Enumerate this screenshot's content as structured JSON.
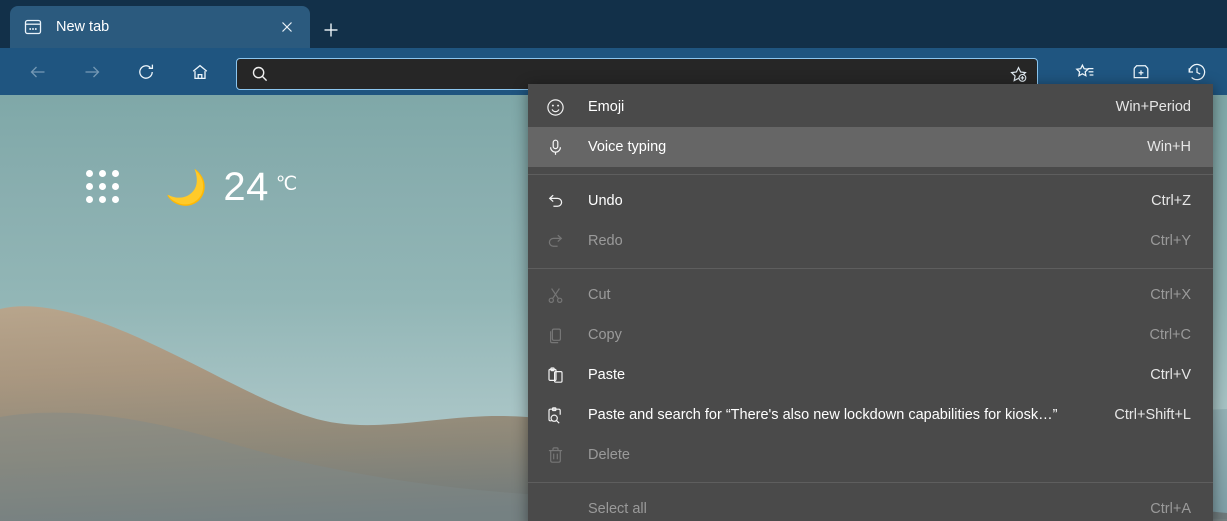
{
  "window": {
    "titlebar_color": "#123049",
    "toolbar_color": "#1f5580",
    "tab_color": "#2b5a7e"
  },
  "tab": {
    "title": "New tab",
    "favicon_icon": "new-tab-page-icon",
    "close_icon": "close-icon",
    "new_tab_icon": "plus-icon"
  },
  "toolbar": {
    "back_icon": "arrow-left-icon",
    "forward_icon": "arrow-right-icon",
    "refresh_icon": "refresh-icon",
    "home_icon": "home-icon",
    "favorites_icon": "favorites-star-list-icon",
    "collections_icon": "collections-icon",
    "history_icon": "history-clock-icon"
  },
  "address_bar": {
    "value": "",
    "placeholder": "",
    "search_icon": "search-icon",
    "add_favorite_icon": "add-favorite-star-icon"
  },
  "new_tab_page": {
    "app_launcher_icon": "app-grid-icon",
    "weather": {
      "icon": "crescent-moon-icon",
      "glyph": "🌙",
      "temperature": "24",
      "unit": "℃"
    },
    "background_description": "grassy hill at dusk under teal sky"
  },
  "context_menu": {
    "background_color": "#4a4a4a",
    "highlight_color": "#666666",
    "items": [
      {
        "id": "emoji",
        "label": "Emoji",
        "accel": "Win+Period",
        "icon": "emoji-smiley-icon",
        "disabled": false,
        "highlighted": false
      },
      {
        "id": "voice",
        "label": "Voice typing",
        "accel": "Win+H",
        "icon": "microphone-icon",
        "disabled": false,
        "highlighted": true
      },
      {
        "id": "undo",
        "label": "Undo",
        "accel": "Ctrl+Z",
        "icon": "undo-arrow-icon",
        "disabled": false,
        "highlighted": false
      },
      {
        "id": "redo",
        "label": "Redo",
        "accel": "Ctrl+Y",
        "icon": "redo-arrow-icon",
        "disabled": true,
        "highlighted": false
      },
      {
        "id": "cut",
        "label": "Cut",
        "accel": "Ctrl+X",
        "icon": "scissors-icon",
        "disabled": true,
        "highlighted": false
      },
      {
        "id": "copy",
        "label": "Copy",
        "accel": "Ctrl+C",
        "icon": "copy-icon",
        "disabled": true,
        "highlighted": false
      },
      {
        "id": "paste",
        "label": "Paste",
        "accel": "Ctrl+V",
        "icon": "clipboard-icon",
        "disabled": false,
        "highlighted": false
      },
      {
        "id": "paste-search",
        "label": "Paste and search for “There's also new lockdown capabilities for kiosk…”",
        "accel": "Ctrl+Shift+L",
        "icon": "clipboard-search-icon",
        "disabled": false,
        "highlighted": false
      },
      {
        "id": "delete",
        "label": "Delete",
        "accel": "",
        "icon": "trash-icon",
        "disabled": true,
        "highlighted": false
      },
      {
        "id": "select-all",
        "label": "Select all",
        "accel": "Ctrl+A",
        "icon": "",
        "disabled": true,
        "highlighted": false
      }
    ]
  }
}
